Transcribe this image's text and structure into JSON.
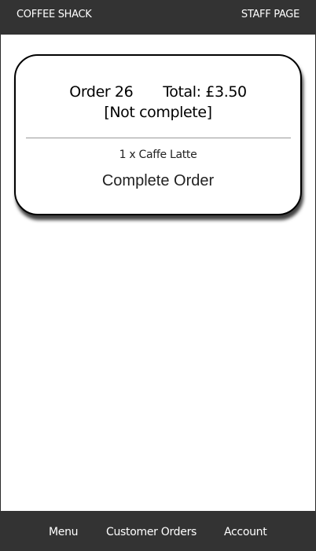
{
  "header": {
    "brand": "COFFEE SHACK",
    "staff_label": "STAFF PAGE"
  },
  "orders": [
    {
      "order_label": "Order 26",
      "total_label": "Total: £3.50",
      "status": "[Not complete]",
      "items": [
        "1 x Caffe Latte"
      ],
      "complete_button_label": "Complete Order"
    }
  ],
  "bottom_nav": {
    "items": [
      {
        "label": "Menu"
      },
      {
        "label": "Customer Orders"
      },
      {
        "label": "Account"
      }
    ]
  },
  "colors": {
    "bar_background": "#333333",
    "bar_text": "#ffffff",
    "card_border": "#000000",
    "divider": "#9a9a9a"
  }
}
